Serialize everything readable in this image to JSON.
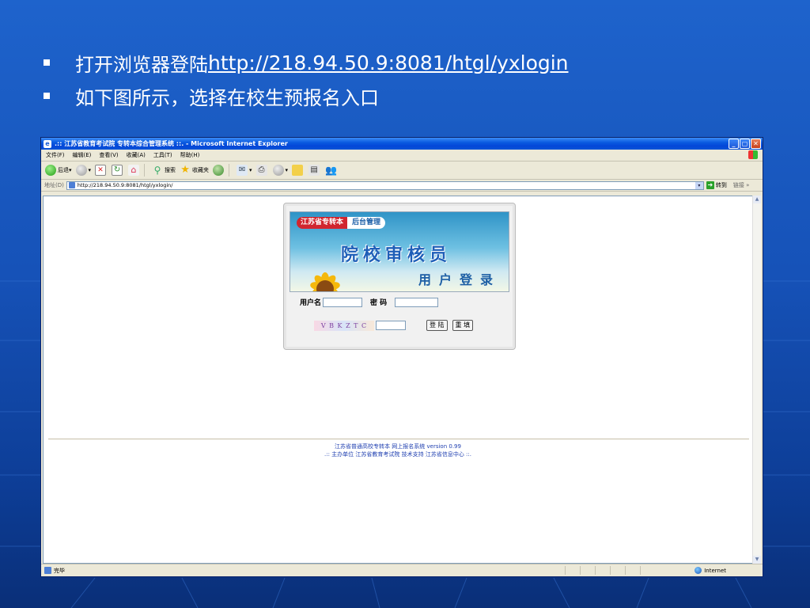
{
  "slide": {
    "bullet1_text": "打开浏览器登陆",
    "bullet1_link": "http://218.94.50.9:8081/htgl/yxlogin",
    "bullet2_text": "如下图所示，选择在校生预报名入口"
  },
  "browser": {
    "title": ".:: 江苏省教育考试院 专转本综合管理系统 ::. - Microsoft Internet Explorer",
    "menu": [
      "文件(F)",
      "编辑(E)",
      "查看(V)",
      "收藏(A)",
      "工具(T)",
      "帮助(H)"
    ],
    "toolbar": {
      "back": "后退",
      "search": "搜索",
      "favorites": "收藏夹"
    },
    "address_label": "地址(D)",
    "address_value": "http://218.94.50.9:8081/htgl/yxlogin/",
    "go_label": "转到",
    "links_label": "链接",
    "status_text": "完毕",
    "zone_text": "Internet"
  },
  "login": {
    "tag_red": "江苏省专转本",
    "tag_white": "后台管理",
    "big_title": "院校审核员",
    "sub_title": "用户登录",
    "username_label": "用户名",
    "password_label": "密 码",
    "captcha": "V B K Z T C",
    "login_button": "登 陆",
    "reset_button": "重 填"
  },
  "footer": {
    "line1": "江苏省普通高校专转本 网上报名系统 version 0.99",
    "line2": ".:: 主办单位 江苏省教育考试院     技术支持 江苏省信息中心 ::."
  },
  "colors": {
    "slide_bg": "#1652b8",
    "ie_title": "#0a5ae0",
    "brand_red": "#d1262f",
    "title_blue": "#1f5fb8"
  }
}
